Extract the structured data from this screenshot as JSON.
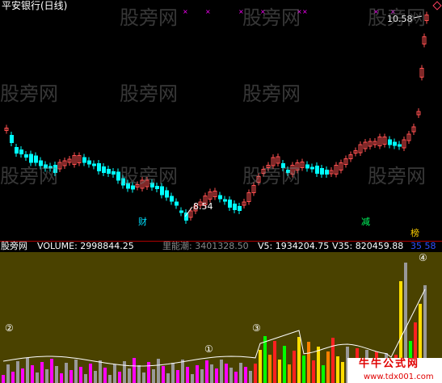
{
  "title": "平安银行(日线)",
  "watermark": "股旁网",
  "price_annotations": {
    "high": "10.58",
    "low": "8.54"
  },
  "tags": {
    "cai": "财",
    "jian": "减",
    "bang": "榜"
  },
  "volume_header": {
    "name": "股旁网",
    "volume": "VOLUME: 2998844.25",
    "energy": "里能潮: 3401328.50",
    "v5": "V5: 1934204.75",
    "v35": "V35: 820459.88",
    "extra": "35  58"
  },
  "circle_marks": [
    "①",
    "②",
    "③",
    "④"
  ],
  "stamp": {
    "brand": "牛牛公式网",
    "url": "www.tdx001.com"
  },
  "colors": {
    "up": "#ff5050",
    "down": "#00ffff",
    "title": "#ffffff",
    "ma": "#ffffff",
    "bg": "#000000",
    "vol_bg": "#4a4200"
  }
}
